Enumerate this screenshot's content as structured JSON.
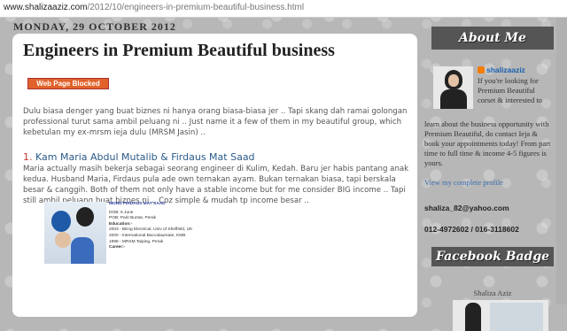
{
  "browser": {
    "url_host": "www.shalizaaziz.com",
    "url_path": "/2012/10/engineers-in-premium-beautiful-business.html"
  },
  "post": {
    "date": "MONDAY, 29 OCTOBER 2012",
    "title": "Engineers in Premium Beautiful business",
    "blocked_label": "Web Page Blocked",
    "paragraph1": "Dulu biasa denger yang buat biznes ni hanya orang biasa-biasa jer .. Tapi skang dah ramai golongan professional turut sama ambil peluang ni .. Just name it a few of them in my beautiful group, which kebetulan my ex-mrsm ieja dulu (MRSM Jasin) ..",
    "heading1_num": "1.",
    "heading1_text": "Kam Maria Abdul Mutalib & Firdaus Mat Saad",
    "paragraph2": "Maria actually masih bekerja sebagai seorang engineer di Kulim, Kedah. Baru jer habis pantang anak kedua. Husband Maria, Firdaus pula ade own ternakan ayam. Bukan ternakan biasa, tapi berskala besar & canggih. Both of them not only have a stable income but for me consider BIG income .. Tapi still ambil peluang buat biznes ni .. Coz simple & mudah tp income besar ..",
    "card": {
      "name": "MOHD FIRDAUS MAT SAAD",
      "dob": "DOB: 6 June",
      "pob": "POB: Parit Buntar, Perak",
      "education_label": "Education:-",
      "edu1": "2003 - BEng Electrical, Univ of Sheffield, UK",
      "edu2": "2000 - International Baccalaureate, KMB",
      "edu3": "1998 - MRSM Taiping, Perak",
      "career_label": "Career:-"
    }
  },
  "sidebar": {
    "about_title": "About Me",
    "blogger_name": "shalizaaziz",
    "about_text_top": "If you're looking for Premium Beautiful corset & interested to",
    "about_text_bottom": "learn about the business opportunity with Premium Beautiful, do contact Ieja & book your appointments today! From part time to full time & income 4-5 figures is yours.",
    "profile_link": "View my complete profile",
    "email": "shaliza_82@yahoo.com",
    "phone": "012-4972602 / 016-3118602",
    "facebook_title": "Facebook Badge",
    "facebook_name": "Shaliza Aziz"
  }
}
